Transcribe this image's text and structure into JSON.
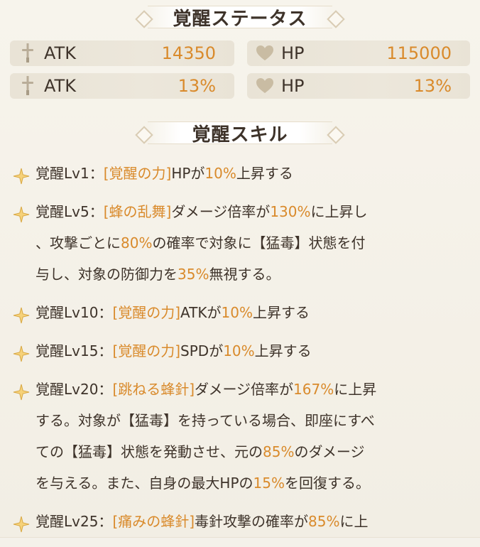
{
  "banners": {
    "status": "覚醒ステータス",
    "skills": "覚醒スキル"
  },
  "stats": [
    {
      "icon": "sword-icon",
      "label": "ATK",
      "value": "14350"
    },
    {
      "icon": "heart-icon",
      "label": "HP",
      "value": "115000"
    },
    {
      "icon": "sword-icon",
      "label": "ATK",
      "value": "13%"
    },
    {
      "icon": "heart-icon",
      "label": "HP",
      "value": "13%"
    }
  ],
  "skills": [
    {
      "lines": [
        [
          {
            "t": "覚醒Lv1："
          },
          {
            "t": "[覚醒の力]",
            "h": true
          },
          {
            "t": "HPが"
          },
          {
            "t": "10%",
            "h": true
          },
          {
            "t": "上昇する"
          }
        ]
      ]
    },
    {
      "lines": [
        [
          {
            "t": "覚醒Lv5："
          },
          {
            "t": "[蜂の乱舞]",
            "h": true
          },
          {
            "t": "ダメージ倍率が"
          },
          {
            "t": "130%",
            "h": true
          },
          {
            "t": "に上昇し"
          }
        ],
        [
          {
            "t": "、攻撃ごとに"
          },
          {
            "t": "80%",
            "h": true
          },
          {
            "t": "の確率で対象に【猛毒】状態を付"
          }
        ],
        [
          {
            "t": "与し、対象の防御力を"
          },
          {
            "t": "35%",
            "h": true
          },
          {
            "t": "無視する。"
          }
        ]
      ]
    },
    {
      "lines": [
        [
          {
            "t": "覚醒Lv10："
          },
          {
            "t": "[覚醒の力]",
            "h": true
          },
          {
            "t": "ATKが"
          },
          {
            "t": "10%",
            "h": true
          },
          {
            "t": "上昇する"
          }
        ]
      ]
    },
    {
      "lines": [
        [
          {
            "t": "覚醒Lv15："
          },
          {
            "t": "[覚醒の力]",
            "h": true
          },
          {
            "t": "SPDが"
          },
          {
            "t": "10%",
            "h": true
          },
          {
            "t": "上昇する"
          }
        ]
      ]
    },
    {
      "lines": [
        [
          {
            "t": "覚醒Lv20："
          },
          {
            "t": "[跳ねる蜂針]",
            "h": true
          },
          {
            "t": "ダメージ倍率が"
          },
          {
            "t": "167%",
            "h": true
          },
          {
            "t": "に上昇"
          }
        ],
        [
          {
            "t": "する。対象が【猛毒】を持っている場合、即座にすべ"
          }
        ],
        [
          {
            "t": "ての【猛毒】状態を発動させ、元の"
          },
          {
            "t": "85%",
            "h": true
          },
          {
            "t": "のダメージ"
          }
        ],
        [
          {
            "t": "を与える。また、自身の最大HPの"
          },
          {
            "t": "15%",
            "h": true
          },
          {
            "t": "を回復する。"
          }
        ]
      ]
    },
    {
      "lines": [
        [
          {
            "t": "覚醒Lv25："
          },
          {
            "t": "[痛みの蜂針]",
            "h": true
          },
          {
            "t": "毒針攻撃の確率が"
          },
          {
            "t": "85%",
            "h": true
          },
          {
            "t": "に上"
          }
        ]
      ]
    }
  ],
  "colors": {
    "accent": "#d98a2b",
    "text": "#3e332a"
  }
}
